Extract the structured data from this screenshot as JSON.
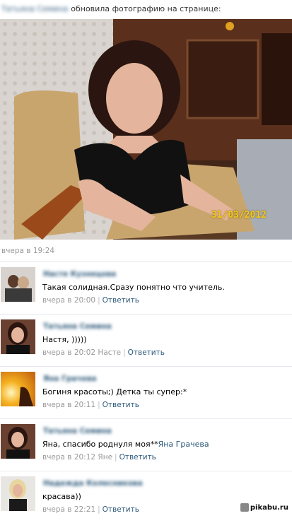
{
  "post": {
    "author": "Татьяна Семина",
    "action": "обновила фотографию на странице:",
    "photo_date": "31/03/2012",
    "time": "вчера в 19:24"
  },
  "comments": [
    {
      "author": "Настя Кузнецова",
      "text": "Такая солидная.Сразу понятно что учитель.",
      "time": "вчера в 20:00",
      "reply_to": "",
      "reply_label": "Ответить"
    },
    {
      "author": "Татьяна Семина",
      "text": "Настя, )))))",
      "time": "вчера в 20:02",
      "reply_to": "Насте",
      "reply_label": "Ответить"
    },
    {
      "author": "Яна Грачева",
      "text": "Богиня красоты;) Детка ты супер:*",
      "time": "вчера в 20:11",
      "reply_to": "",
      "reply_label": "Ответить"
    },
    {
      "author": "Татьяна Семина",
      "text": "Яна, спасибо роднуля моя**",
      "text_link": "Яна Грачева",
      "time": "вчера в 20:12",
      "reply_to": "Яне",
      "reply_label": "Ответить"
    },
    {
      "author": "Надежда Колесникова",
      "text": "красава))",
      "time": "вчера в 22:21",
      "reply_to": "",
      "reply_label": "Ответить"
    }
  ],
  "watermark": "pikabu.ru",
  "colors": {
    "link": "#2b587a",
    "meta": "#999999",
    "divider": "#e4e8ed",
    "date_stamp": "#f3c91c"
  }
}
